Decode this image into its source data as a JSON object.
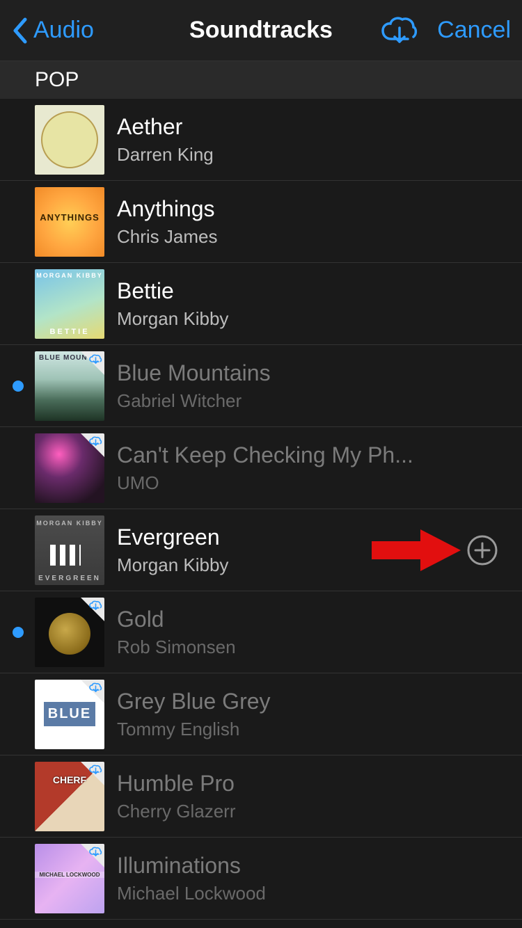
{
  "header": {
    "back_label": "Audio",
    "title": "Soundtracks",
    "cancel_label": "Cancel"
  },
  "section": {
    "title": "POP"
  },
  "tracks": [
    {
      "title": "Aether",
      "artist": "Darren King",
      "state": "bright",
      "dot": false,
      "cloud_badge": false,
      "add": false,
      "art": "art-aether",
      "text1": "",
      "text2": ""
    },
    {
      "title": "Anythings",
      "artist": "Chris James",
      "state": "bright",
      "dot": false,
      "cloud_badge": false,
      "add": false,
      "art": "art-anythings",
      "text1": "ANYTHINGS",
      "text2": ""
    },
    {
      "title": "Bettie",
      "artist": "Morgan Kibby",
      "state": "bright",
      "dot": false,
      "cloud_badge": false,
      "add": false,
      "art": "art-bettie",
      "text1": "MORGAN KIBBY",
      "text2": "BETTIE"
    },
    {
      "title": "Blue Mountains",
      "artist": "Gabriel Witcher",
      "state": "dim",
      "dot": true,
      "cloud_badge": true,
      "add": false,
      "art": "art-bluemoun",
      "text1": "BLUE MOUN",
      "text2": ""
    },
    {
      "title": "Can't Keep Checking My Ph...",
      "artist": "UMO",
      "state": "dim",
      "dot": false,
      "cloud_badge": true,
      "add": false,
      "art": "art-umo",
      "text1": "",
      "text2": ""
    },
    {
      "title": "Evergreen",
      "artist": "Morgan Kibby",
      "state": "bright",
      "dot": false,
      "cloud_badge": false,
      "add": true,
      "arrow": true,
      "art": "art-evergreen",
      "text1": "MORGAN KIBBY",
      "text2": "EVERGREEN"
    },
    {
      "title": "Gold",
      "artist": "Rob Simonsen",
      "state": "dim",
      "dot": true,
      "cloud_badge": true,
      "add": false,
      "art": "art-gold",
      "text1": "",
      "text2": ""
    },
    {
      "title": "Grey Blue Grey",
      "artist": "Tommy English",
      "state": "dim",
      "dot": false,
      "cloud_badge": true,
      "add": false,
      "art": "art-grey",
      "text1": "",
      "text2": ""
    },
    {
      "title": "Humble Pro",
      "artist": "Cherry Glazerr",
      "state": "dim",
      "dot": false,
      "cloud_badge": true,
      "add": false,
      "art": "art-humble",
      "text1": "CHERF",
      "text2": ""
    },
    {
      "title": "Illuminations",
      "artist": "Michael Lockwood",
      "state": "dim",
      "dot": false,
      "cloud_badge": true,
      "add": false,
      "art": "art-illum",
      "text1": "MICHAEL LOCKWOOD",
      "text2": ""
    }
  ]
}
